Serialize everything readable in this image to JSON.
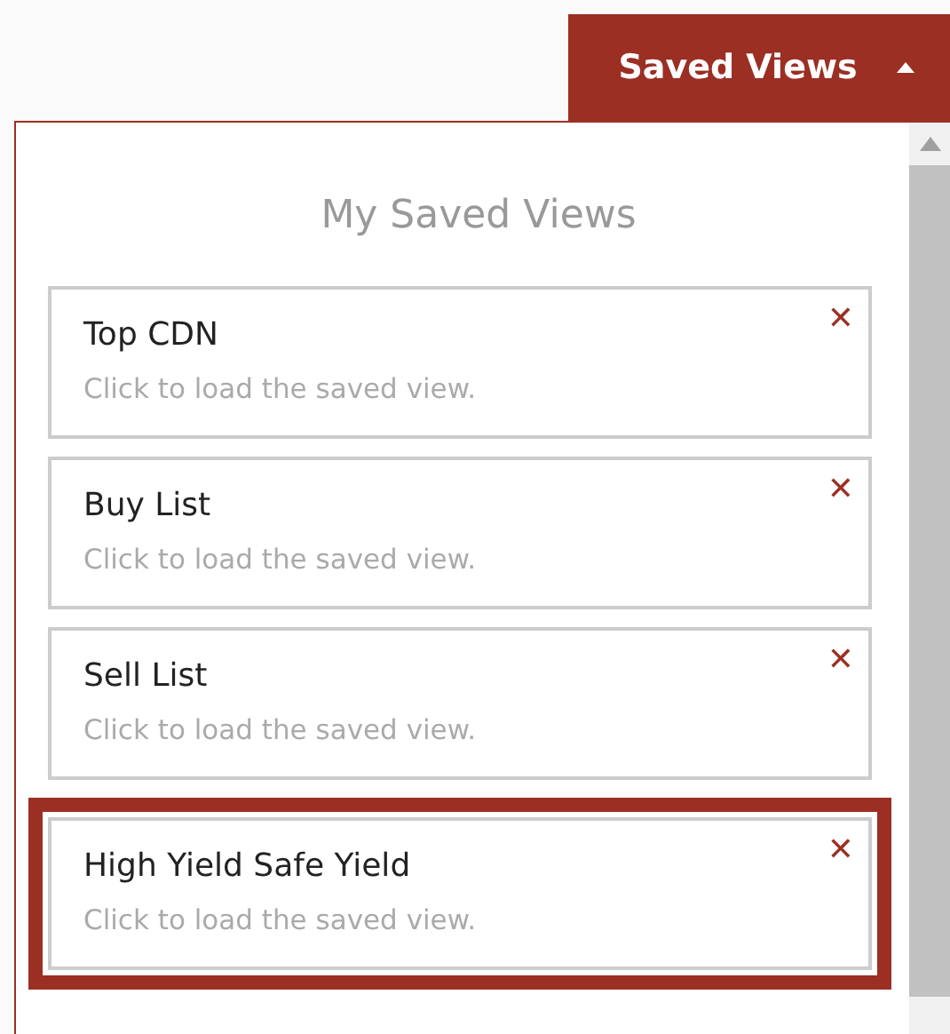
{
  "toggle": {
    "label": "Saved Views",
    "expanded": true
  },
  "panel": {
    "title": "My Saved Views",
    "views": [
      {
        "name": "Top CDN",
        "hint": "Click to load the saved view.",
        "delete": "✕",
        "highlighted": false
      },
      {
        "name": "Buy List",
        "hint": "Click to load the saved view.",
        "delete": "✕",
        "highlighted": false
      },
      {
        "name": "Sell List",
        "hint": "Click to load the saved view.",
        "delete": "✕",
        "highlighted": false
      },
      {
        "name": "High Yield Safe Yield",
        "hint": "Click to load the saved view.",
        "delete": "✕",
        "highlighted": true
      }
    ]
  }
}
